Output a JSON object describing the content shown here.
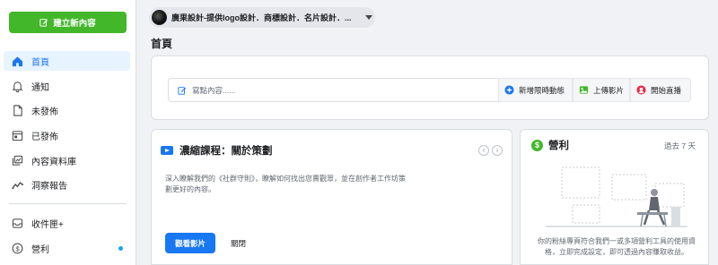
{
  "sidebar": {
    "create_label": "建立新內容",
    "items": [
      {
        "label": "首頁"
      },
      {
        "label": "通知"
      },
      {
        "label": "未發佈"
      },
      {
        "label": "已發佈"
      },
      {
        "label": "內容資料庫"
      },
      {
        "label": "洞察報告"
      },
      {
        "label": "收件匣+"
      },
      {
        "label": "營利"
      }
    ]
  },
  "header": {
    "page_name": "廣果設計-提供logo設計．商標設計．名片設計．..."
  },
  "main": {
    "title": "首頁",
    "composer": {
      "placeholder": "寫點內容......",
      "story_label": "新增限時動態",
      "upload_label": "上傳影片",
      "live_label": "開始直播"
    },
    "course": {
      "title": "濃縮課程：關於策劃",
      "description": "深入瞭解我們的《社群守則》，瞭解如何找出您賣觀眾，並在創作者工作坊策劃更好的內容。",
      "watch_label": "觀看影片",
      "close_label": "關閉"
    },
    "monetization": {
      "title": "營利",
      "period": "過去 7 天",
      "description": "你的粉絲專頁符合我們一或多項營利工具的使用資格，立即完成設定，即可透過內容賺取收益。"
    }
  },
  "colors": {
    "accent": "#1877f2",
    "create": "#42b72a",
    "active_bg": "#e7f3ff"
  }
}
